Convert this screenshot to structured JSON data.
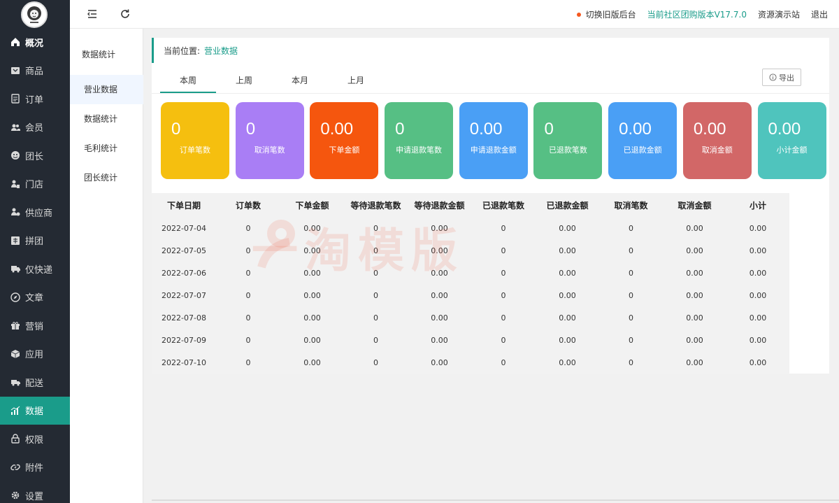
{
  "sidebar": {
    "items": [
      {
        "label": "概况",
        "icon": "home-icon"
      },
      {
        "label": "商品",
        "icon": "product-icon"
      },
      {
        "label": "订单",
        "icon": "order-icon"
      },
      {
        "label": "会员",
        "icon": "members-icon"
      },
      {
        "label": "团长",
        "icon": "leader-icon"
      },
      {
        "label": "门店",
        "icon": "store-icon"
      },
      {
        "label": "供应商",
        "icon": "supplier-icon"
      },
      {
        "label": "拼团",
        "icon": "group-buy-icon"
      },
      {
        "label": "仅快递",
        "icon": "delivery-truck-icon"
      },
      {
        "label": "文章",
        "icon": "compass-icon"
      },
      {
        "label": "营销",
        "icon": "gift-icon"
      },
      {
        "label": "应用",
        "icon": "cube-icon"
      },
      {
        "label": "配送",
        "icon": "truck-icon"
      },
      {
        "label": "数据",
        "icon": "chart-icon"
      },
      {
        "label": "权限",
        "icon": "lock-icon"
      },
      {
        "label": "附件",
        "icon": "link-icon"
      },
      {
        "label": "设置",
        "icon": "gear-icon"
      }
    ],
    "active_index": 13
  },
  "topbar": {
    "switch_label": "切换旧版后台",
    "version_label": "当前社区团购版本V17.7.0",
    "demo_label": "资源演示站",
    "logout_label": "退出"
  },
  "subnav": {
    "title": "数据统计",
    "items": [
      "营业数据",
      "数据统计",
      "毛利统计",
      "团长统计"
    ],
    "active_index": 0
  },
  "breadcrumb": {
    "prefix": "当前位置:",
    "current": "营业数据"
  },
  "tabs": [
    "本周",
    "上周",
    "本月",
    "上月"
  ],
  "export_label": "导出",
  "cards": [
    {
      "value": "0",
      "label": "订单笔数",
      "color": "#f5bf0f"
    },
    {
      "value": "0",
      "label": "取消笔数",
      "color": "#a97ef5"
    },
    {
      "value": "0.00",
      "label": "下单金额",
      "color": "#f5560e"
    },
    {
      "value": "0",
      "label": "申请退款笔数",
      "color": "#56bf84"
    },
    {
      "value": "0.00",
      "label": "申请退款金额",
      "color": "#4a9ff5"
    },
    {
      "value": "0",
      "label": "已退款笔数",
      "color": "#56bf84"
    },
    {
      "value": "0.00",
      "label": "已退款金额",
      "color": "#4a9ff5"
    },
    {
      "value": "0.00",
      "label": "取消金额",
      "color": "#d26767"
    },
    {
      "value": "0.00",
      "label": "小计金额",
      "color": "#4fc4bd"
    }
  ],
  "table": {
    "headers": [
      "下单日期",
      "订单数",
      "下单金额",
      "等待退款笔数",
      "等待退款金额",
      "已退款笔数",
      "已退款金额",
      "取消笔数",
      "取消金额",
      "小计"
    ],
    "rows": [
      [
        "2022-07-04",
        "0",
        "0.00",
        "0",
        "0.00",
        "0",
        "0.00",
        "0",
        "0.00",
        "0.00"
      ],
      [
        "2022-07-05",
        "0",
        "0.00",
        "0",
        "0.00",
        "0",
        "0.00",
        "0",
        "0.00",
        "0.00"
      ],
      [
        "2022-07-06",
        "0",
        "0.00",
        "0",
        "0.00",
        "0",
        "0.00",
        "0",
        "0.00",
        "0.00"
      ],
      [
        "2022-07-07",
        "0",
        "0.00",
        "0",
        "0.00",
        "0",
        "0.00",
        "0",
        "0.00",
        "0.00"
      ],
      [
        "2022-07-08",
        "0",
        "0.00",
        "0",
        "0.00",
        "0",
        "0.00",
        "0",
        "0.00",
        "0.00"
      ],
      [
        "2022-07-09",
        "0",
        "0.00",
        "0",
        "0.00",
        "0",
        "0.00",
        "0",
        "0.00",
        "0.00"
      ],
      [
        "2022-07-10",
        "0",
        "0.00",
        "0",
        "0.00",
        "0",
        "0.00",
        "0",
        "0.00",
        "0.00"
      ]
    ]
  },
  "watermark": "一淘模版",
  "colors": {
    "accent": "#1a9c8a",
    "sidebar_bg": "#242a33"
  }
}
